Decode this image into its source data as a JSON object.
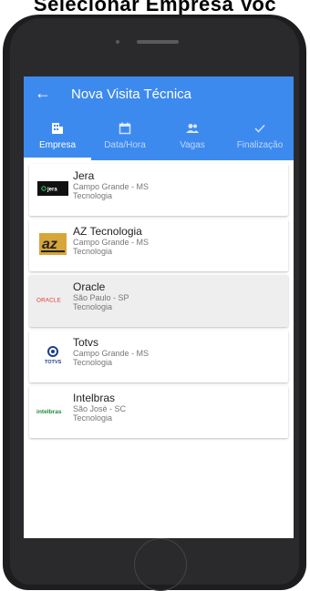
{
  "header": {
    "caption": "Selecionar Empresa Voc"
  },
  "appbar": {
    "title": "Nova Visita Técnica"
  },
  "tabs": [
    {
      "label": "Empresa",
      "icon": "building-icon",
      "active": true
    },
    {
      "label": "Data/Hora",
      "icon": "calendar-icon",
      "active": false
    },
    {
      "label": "Vagas",
      "icon": "people-icon",
      "active": false
    },
    {
      "label": "Finalização",
      "icon": "check-icon",
      "active": false
    }
  ],
  "companies": [
    {
      "name": "Jera",
      "location": "Campo Grande - MS",
      "category": "Tecnologia",
      "logo_text": "jera",
      "selected": false
    },
    {
      "name": "AZ Tecnologia",
      "location": "Campo Grande - MS",
      "category": "Tecnologia",
      "logo_text": "az",
      "selected": false
    },
    {
      "name": "Oracle",
      "location": "São Paulo - SP",
      "category": "Tecnologia",
      "logo_text": "ORACLE",
      "selected": true
    },
    {
      "name": "Totvs",
      "location": "Campo Grande - MS",
      "category": "Tecnologia",
      "logo_text": "TOTVS",
      "selected": false
    },
    {
      "name": "Intelbras",
      "location": "São José - SC",
      "category": "Tecnologia",
      "logo_text": "intelbras",
      "selected": false
    }
  ],
  "colors": {
    "primary": "#3d8aef",
    "oracle": "#e03a2f",
    "intelbras": "#1f8a3a",
    "totvs": "#1a3f8f"
  }
}
